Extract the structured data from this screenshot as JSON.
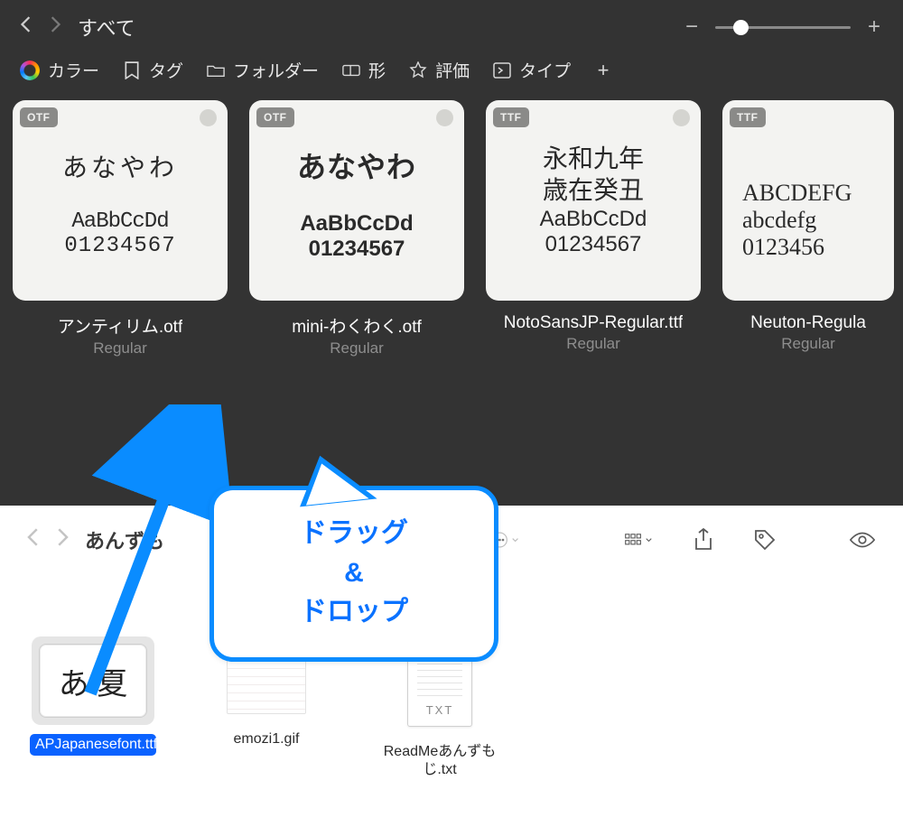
{
  "topApp": {
    "navTitle": "すべて",
    "zoom": {
      "minus": "−",
      "plus": "+",
      "thumbPos": 20
    },
    "filters": {
      "color": "カラー",
      "tag": "タグ",
      "folder": "フォルダー",
      "shape": "形",
      "rating": "評価",
      "type": "タイプ"
    },
    "cards": [
      {
        "badge": "OTF",
        "jp": "あなやわ",
        "abc": "AaBbCcDd",
        "num": "01234567",
        "name": "アンティリム.otf",
        "style": "Regular",
        "variant": "thin"
      },
      {
        "badge": "OTF",
        "jp": "あなやわ",
        "abc": "AaBbCcDd",
        "num": "01234567",
        "name": "mini-わくわく.otf",
        "style": "Regular",
        "variant": "cute"
      },
      {
        "badge": "TTF",
        "jp": "永和九年\n歳在癸丑",
        "abc": "AaBbCcDd",
        "num": "01234567",
        "name": "NotoSansJP-Regular.ttf",
        "style": "Regular",
        "variant": "serifjp"
      },
      {
        "badge": "TTF",
        "jp": "",
        "abc": "ABCDEFG",
        "abc2": "abcdefg",
        "num": "0123456",
        "name": "Neuton-Regula",
        "style": "Regular",
        "variant": "neuton"
      }
    ]
  },
  "finder": {
    "title": "あんずも",
    "breadcrumb": "あんずもじ",
    "files": [
      {
        "label": "APJapanesefont.ttf",
        "kind": "font",
        "sample": "あ 夏",
        "selected": true
      },
      {
        "label": "emozi1.gif",
        "kind": "gif"
      },
      {
        "label": "ReadMeあんずもじ.txt",
        "kind": "txt",
        "badge": "TXT"
      }
    ]
  },
  "annotation": {
    "line1": "ドラッグ",
    "line2": "&",
    "line3": "ドロップ"
  }
}
